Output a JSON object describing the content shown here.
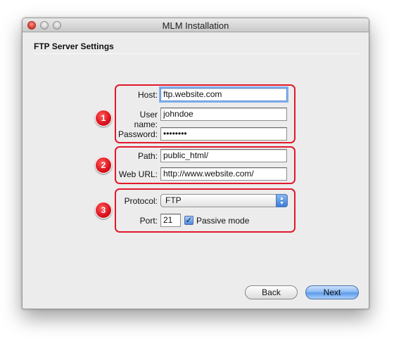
{
  "window": {
    "title": "MLM Installation"
  },
  "section": {
    "title": "FTP Server Settings"
  },
  "badges": [
    "1",
    "2",
    "3"
  ],
  "form": {
    "host_label": "Host:",
    "host_value": "ftp.website.com",
    "username_label": "User name:",
    "username_value": "johndoe",
    "password_label": "Password:",
    "password_value": "••••••••",
    "path_label": "Path:",
    "path_value": "public_html/",
    "weburl_label": "Web URL:",
    "weburl_value": "http://www.website.com/",
    "protocol_label": "Protocol:",
    "protocol_value": "FTP",
    "port_label": "Port:",
    "port_value": "21",
    "passive_label": "Passive mode",
    "passive_checked": true
  },
  "buttons": {
    "back_label": "Back",
    "next_label": "Next"
  },
  "colors": {
    "annotation_red": "#e2182a",
    "accent_blue": "#5e9be8",
    "window_bg": "#ececec"
  }
}
